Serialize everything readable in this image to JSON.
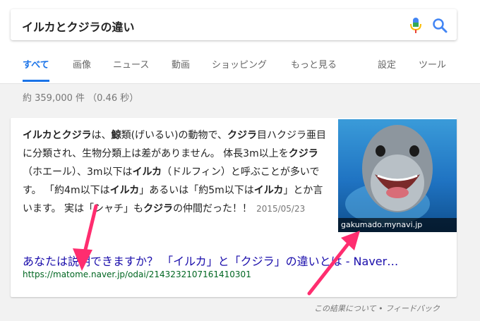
{
  "search": {
    "query": "イルカとクジラの違い"
  },
  "tabs": [
    {
      "label": "すべて"
    },
    {
      "label": "画像"
    },
    {
      "label": "ニュース"
    },
    {
      "label": "動画"
    },
    {
      "label": "ショッピング"
    },
    {
      "label": "もっと見る"
    },
    {
      "label": "設定"
    },
    {
      "label": "ツール"
    }
  ],
  "stats": "約 359,000 件 （0.46 秒）",
  "snippet": {
    "parts": [
      {
        "text": "イルカとクジラ",
        "bold": true
      },
      {
        "text": "は、",
        "bold": false
      },
      {
        "text": "鯨",
        "bold": true
      },
      {
        "text": "類(げいるい)の動物で、",
        "bold": false
      },
      {
        "text": "クジラ",
        "bold": true
      },
      {
        "text": "目ハクジラ亜目に分類され、生物分類上は差がありません。 体長3m以上を",
        "bold": false
      },
      {
        "text": "クジラ",
        "bold": true
      },
      {
        "text": "（ホエール）、3m以下は",
        "bold": false
      },
      {
        "text": "イルカ",
        "bold": true
      },
      {
        "text": "（ドルフィン）と呼ぶことが多いです。 「約4m以下は",
        "bold": false
      },
      {
        "text": "イルカ",
        "bold": true
      },
      {
        "text": "」あるいは「約5m以下は",
        "bold": false
      },
      {
        "text": "イルカ",
        "bold": true
      },
      {
        "text": "」とか言います。 実は「シャチ」も",
        "bold": false
      },
      {
        "text": "クジラ",
        "bold": true
      },
      {
        "text": "の仲間だった！！",
        "bold": false
      }
    ],
    "date": "2015/05/23"
  },
  "image": {
    "source": "gakumado.mynavi.jp"
  },
  "result": {
    "title": "あなたは説明できますか？ 「イルカ」と「クジラ」の違いとは - Naver…",
    "url": "https://matome.naver.jp/odai/2143232107161410301"
  },
  "feedback": "この結果について • フィードバック",
  "colors": {
    "accent": "#1a73e8",
    "link": "#1a0dab",
    "url": "#006621",
    "arrow": "#ff2d6f"
  }
}
